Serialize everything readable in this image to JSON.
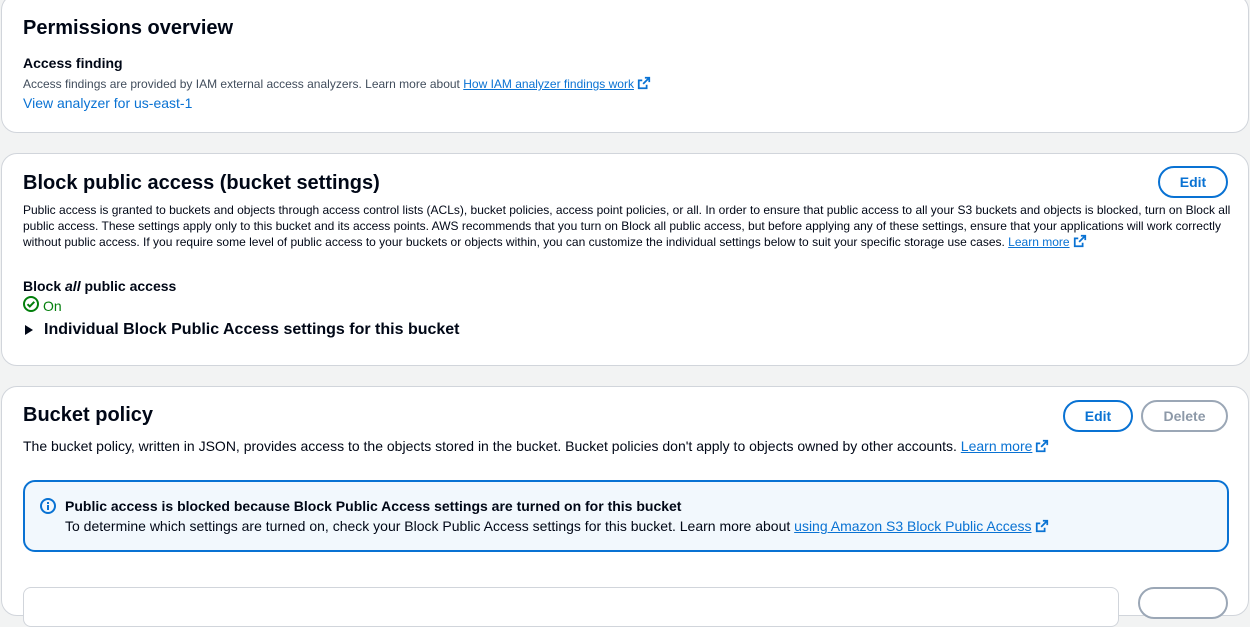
{
  "permissions_overview": {
    "title": "Permissions overview",
    "access_finding_label": "Access finding",
    "description": "Access findings are provided by IAM external access analyzers. Learn more about ",
    "findings_link": "How IAM analyzer findings work",
    "analyzer_link": "View analyzer for us-east-1"
  },
  "block_public_access": {
    "title": "Block public access (bucket settings)",
    "edit_label": "Edit",
    "description": "Public access is granted to buckets and objects through access control lists (ACLs), bucket policies, access point policies, or all. In order to ensure that public access to all your S3 buckets and objects is blocked, turn on Block all public access. These settings apply only to this bucket and its access points. AWS recommends that you turn on Block all public access, but before applying any of these settings, ensure that your applications will work correctly without public access. If you require some level of public access to your buckets or objects within, you can customize the individual settings below to suit your specific storage use cases.",
    "learn_more": "Learn more",
    "block_all_label_prefix": "Block ",
    "block_all_label_em": "all",
    "block_all_label_suffix": " public access",
    "status": "On",
    "status_color": "#037f0c",
    "expander_label": "Individual Block Public Access settings for this bucket"
  },
  "bucket_policy": {
    "title": "Bucket policy",
    "edit_label": "Edit",
    "delete_label": "Delete",
    "description": "The bucket policy, written in JSON, provides access to the objects stored in the bucket. Bucket policies don't apply to objects owned by other accounts. ",
    "learn_more": "Learn more",
    "alert": {
      "title": "Public access is blocked because Block Public Access settings are turned on for this bucket",
      "body": "To determine which settings are turned on, check your Block Public Access settings for this bucket. Learn more about ",
      "link": "using Amazon S3 Block Public Access"
    }
  },
  "colors": {
    "link": "#0972d3",
    "info_background": "#f2f8fd",
    "success": "#037f0c"
  },
  "icons": {
    "external": "external-link-icon",
    "status_success": "status-positive-icon",
    "info": "status-info-icon",
    "caret": "caret-right-filled-icon"
  }
}
